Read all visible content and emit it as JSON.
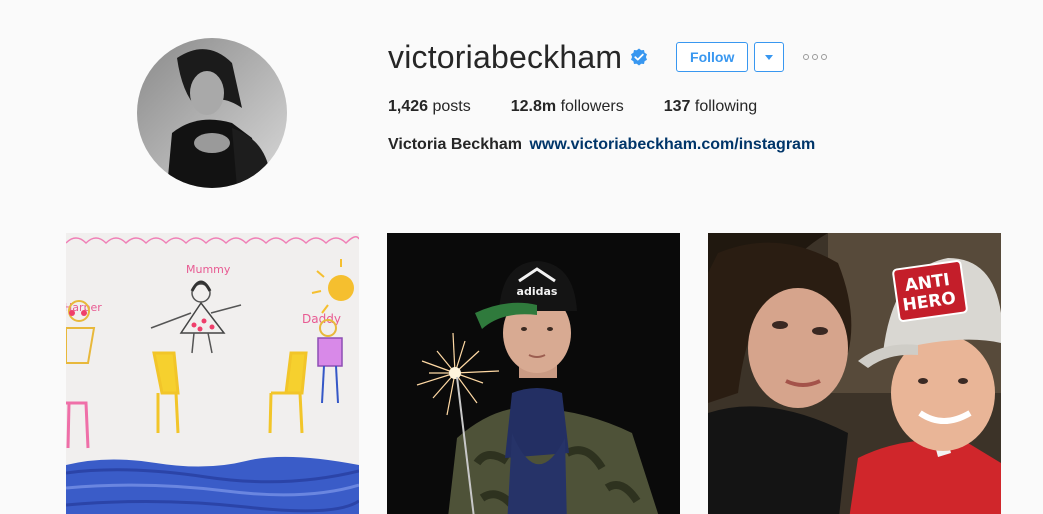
{
  "profile": {
    "username": "victoriabeckham",
    "verified": true,
    "follow_label": "Follow",
    "stats": {
      "posts_count": "1,426",
      "posts_label": "posts",
      "followers_count": "12.8m",
      "followers_label": "followers",
      "following_count": "137",
      "following_label": "following"
    },
    "bio_name": "Victoria Beckham",
    "bio_link": "www.victoriabeckham.com/instagram"
  },
  "colors": {
    "accent": "#3897f0",
    "link": "#003569",
    "background": "#fafafa",
    "text": "#262626"
  },
  "icons": {
    "verified": "verified-badge-icon",
    "dropdown": "chevron-down-icon",
    "more": "more-options-icon"
  },
  "posts": [
    {
      "subject": "child-drawing",
      "drawing_labels": [
        "Harper",
        "Mummy",
        "Daddy"
      ]
    },
    {
      "subject": "sparkler-portrait",
      "cap_text": "adidas"
    },
    {
      "subject": "selfie",
      "cap_text": [
        "ANTI",
        "HERO"
      ]
    }
  ]
}
